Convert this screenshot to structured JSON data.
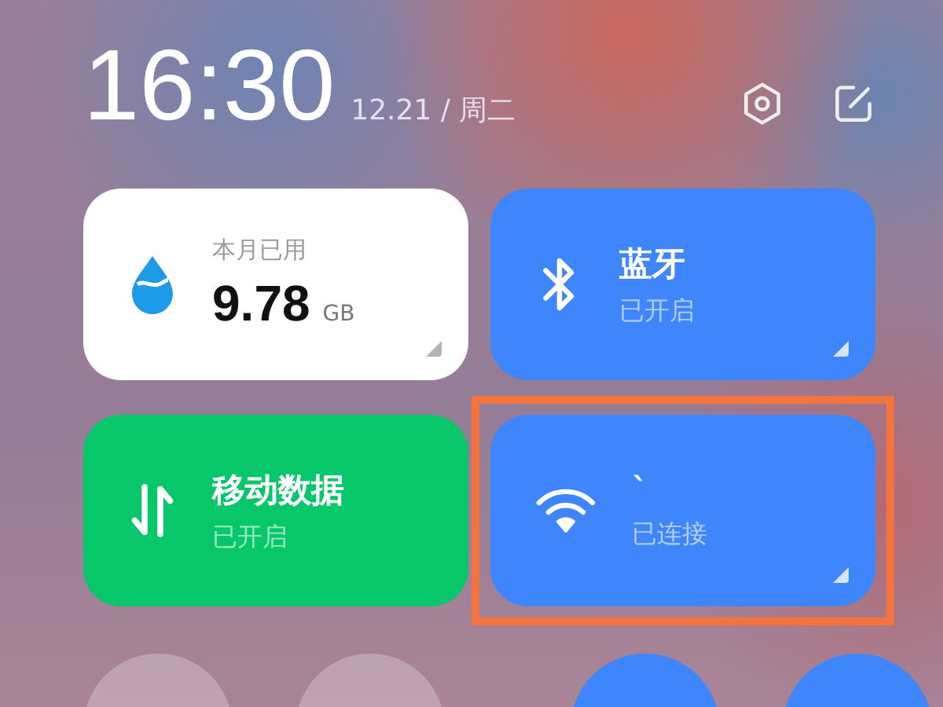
{
  "header": {
    "time": "16:30",
    "date": "12.21 / 周二"
  },
  "tiles": [
    {
      "kind": "usage",
      "label": "本月已用",
      "value": "9.78",
      "unit": "GB",
      "color": "#ffffff",
      "has_details": true,
      "highlighted": false
    },
    {
      "kind": "bluetooth",
      "title": "蓝牙",
      "status": "已开启",
      "color": "#3f86fc",
      "has_details": true,
      "highlighted": false
    },
    {
      "kind": "mobile_data",
      "title": "移动数据",
      "status": "已开启",
      "color": "#08c76a",
      "has_details": false,
      "highlighted": false
    },
    {
      "kind": "wifi",
      "title": "`",
      "status": "已连接",
      "color": "#3f86fc",
      "has_details": true,
      "highlighted": true
    }
  ],
  "round_toggles": [
    {
      "on": false
    },
    {
      "on": false
    },
    {
      "on": true
    },
    {
      "on": true
    }
  ]
}
